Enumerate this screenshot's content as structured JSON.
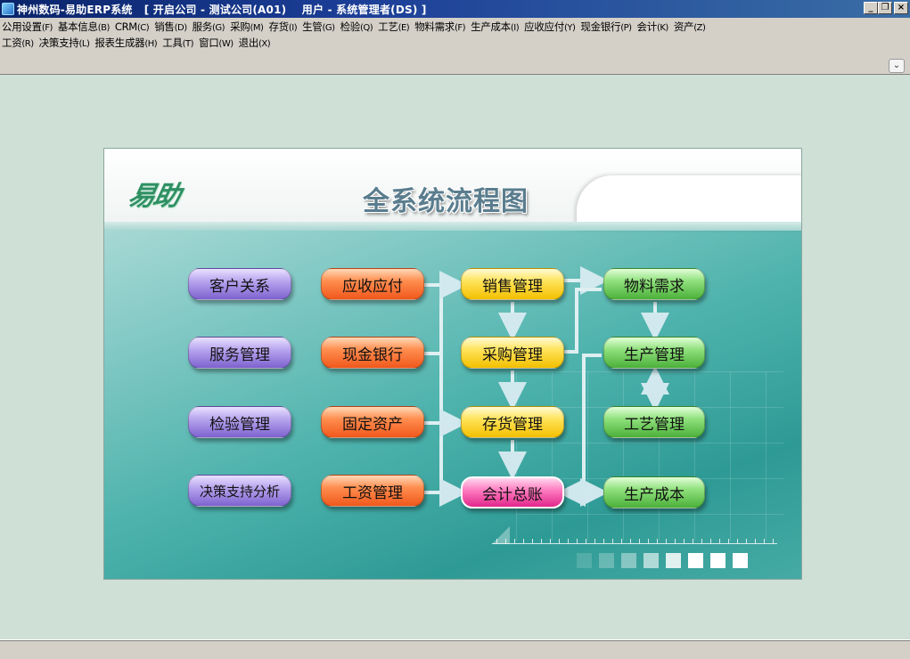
{
  "window": {
    "title": "神州数码-易助ERP系统   [ 开启公司 - 测试公司(A01)    用户 - 系统管理者(DS) ]",
    "controls": {
      "minimize": "_",
      "restore": "❐",
      "close": "×"
    }
  },
  "menu": {
    "row1": [
      {
        "label": "公用设置",
        "key": "(F)"
      },
      {
        "label": "基本信息",
        "key": "(B)"
      },
      {
        "label": "CRM",
        "key": "(C)"
      },
      {
        "label": "销售",
        "key": "(D)"
      },
      {
        "label": "服务",
        "key": "(G)"
      },
      {
        "label": "采购",
        "key": "(M)"
      },
      {
        "label": "存货",
        "key": "(I)"
      },
      {
        "label": "生管",
        "key": "(G)"
      },
      {
        "label": "检验",
        "key": "(Q)"
      },
      {
        "label": "工艺",
        "key": "(E)"
      },
      {
        "label": "物料需求",
        "key": "(F)"
      },
      {
        "label": "生产成本",
        "key": "(I)"
      },
      {
        "label": "应收应付",
        "key": "(Y)"
      },
      {
        "label": "现金银行",
        "key": "(P)"
      },
      {
        "label": "会计",
        "key": "(K)"
      },
      {
        "label": "资产",
        "key": "(Z)"
      }
    ],
    "row2": [
      {
        "label": "工资",
        "key": "(R)"
      },
      {
        "label": "决策支持",
        "key": "(L)"
      },
      {
        "label": "报表生成器",
        "key": "(H)"
      },
      {
        "label": "工具",
        "key": "(T)"
      },
      {
        "label": "窗口",
        "key": "(W)"
      },
      {
        "label": "退出",
        "key": "(X)"
      }
    ],
    "chevron": "⌄"
  },
  "panel": {
    "logo_text": "易助",
    "title": "全系统流程图",
    "nodes": {
      "customer": "客户关系",
      "service": "服务管理",
      "inspection": "检验管理",
      "decision": "决策支持分析",
      "receivable": "应收应付",
      "cash": "现金银行",
      "assets": "固定资产",
      "payroll": "工资管理",
      "sales": "销售管理",
      "purchase": "采购管理",
      "inventory": "存货管理",
      "ledger": "会计总账",
      "mrp": "物料需求",
      "production": "生产管理",
      "process": "工艺管理",
      "cost": "生产成本"
    }
  },
  "colors": {
    "titlebar": "#0a246a",
    "purple": "#7d62cf",
    "orange": "#f0581c",
    "yellow": "#f3c000",
    "green": "#4bb03a",
    "pink": "#e1278b",
    "background": "#cfe0d6"
  }
}
